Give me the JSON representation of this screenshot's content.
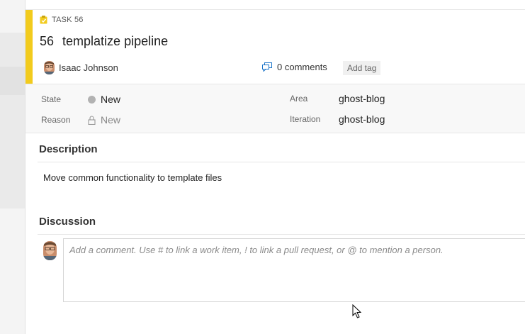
{
  "work_item": {
    "type_label": "TASK 56",
    "id": "56",
    "title": "templatize pipeline",
    "assignee": "Isaac Johnson",
    "comments_label": "0 comments",
    "add_tag_label": "Add tag",
    "accent_color": "#f2cb1d"
  },
  "fields": {
    "state": {
      "label": "State",
      "value": "New"
    },
    "reason": {
      "label": "Reason",
      "value": "New"
    },
    "area": {
      "label": "Area",
      "value": "ghost-blog"
    },
    "iteration": {
      "label": "Iteration",
      "value": "ghost-blog"
    }
  },
  "description": {
    "header": "Description",
    "body": "Move common functionality to template files"
  },
  "discussion": {
    "header": "Discussion",
    "placeholder": "Add a comment. Use # to link a work item, ! to link a pull request, or @ to mention a person."
  },
  "icons": {
    "type": "task-clipboard-icon",
    "comments": "comments-icon",
    "reason_lock": "lock-icon",
    "state_indicator": "state-dot-icon",
    "pointer": "mouse-cursor-icon"
  }
}
